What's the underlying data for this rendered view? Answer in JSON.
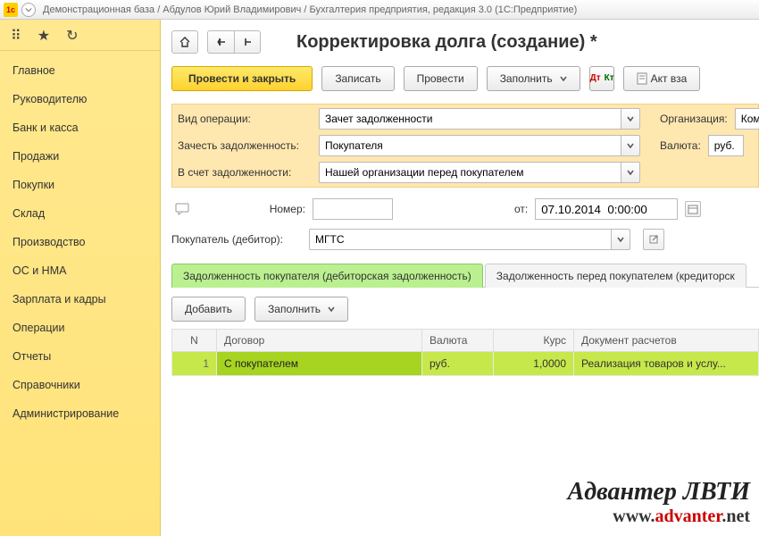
{
  "window": {
    "title": "Демонстрационная база / Абдулов Юрий Владимирович / Бухгалтерия предприятия, редакция 3.0  (1С:Предприятие)"
  },
  "sidebar": {
    "items": [
      {
        "label": "Главное"
      },
      {
        "label": "Руководителю"
      },
      {
        "label": "Банк и касса"
      },
      {
        "label": "Продажи"
      },
      {
        "label": "Покупки"
      },
      {
        "label": "Склад"
      },
      {
        "label": "Производство"
      },
      {
        "label": "ОС и НМА"
      },
      {
        "label": "Зарплата и кадры"
      },
      {
        "label": "Операции"
      },
      {
        "label": "Отчеты"
      },
      {
        "label": "Справочники"
      },
      {
        "label": "Администрирование"
      }
    ]
  },
  "page": {
    "title": "Корректировка долга (создание) *"
  },
  "toolbar": {
    "post_close": "Провести и закрыть",
    "save": "Записать",
    "post": "Провести",
    "fill": "Заполнить",
    "act": "Акт вза"
  },
  "params": {
    "operation_label": "Вид операции:",
    "operation_value": "Зачет задолженности",
    "offset_label": "Зачесть задолженность:",
    "offset_value": "Покупателя",
    "against_label": "В счет задолженности:",
    "against_value": "Нашей организации перед покупателем",
    "org_label": "Организация:",
    "org_value": "Комф",
    "currency_label": "Валюта:",
    "currency_value": "руб."
  },
  "doc": {
    "number_label": "Номер:",
    "number_value": "",
    "from_label": "от:",
    "date_value": "07.10.2014  0:00:00",
    "buyer_label": "Покупатель (дебитор):",
    "buyer_value": "МГТС"
  },
  "tabs": {
    "t1": "Задолженность покупателя (дебиторская задолженность)",
    "t2": "Задолженность перед покупателем (кредиторск"
  },
  "tab_toolbar": {
    "add": "Добавить",
    "fill": "Заполнить"
  },
  "grid": {
    "headers": {
      "n": "N",
      "contract": "Договор",
      "currency": "Валюта",
      "rate": "Курс",
      "docs": "Документ расчетов"
    },
    "rows": [
      {
        "n": "1",
        "contract": "С покупателем",
        "currency": "руб.",
        "rate": "1,0000",
        "docs": "Реализация товаров и услу..."
      }
    ]
  },
  "watermark": {
    "l1": "Адвантер ЛВТИ",
    "l2a": "www.",
    "l2b": "advanter",
    "l2c": ".net"
  }
}
